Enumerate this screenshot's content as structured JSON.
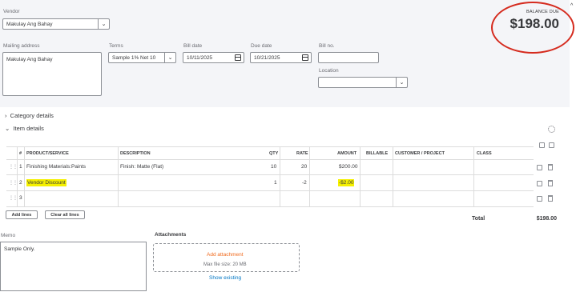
{
  "header": {
    "vendor_label": "Vendor",
    "vendor_value": "Makulay Ang Bahay",
    "balance_label": "BALANCE DUE",
    "balance_value": "$198.00",
    "mailing_label": "Mailing address",
    "mailing_value": "Makulay Ang Bahay",
    "terms_label": "Terms",
    "terms_value": "Sample 1% Net 10",
    "bill_date_label": "Bill date",
    "bill_date_value": "10/11/2025",
    "due_date_label": "Due date",
    "due_date_value": "10/21/2025",
    "bill_no_label": "Bill no.",
    "bill_no_value": "",
    "location_label": "Location",
    "location_value": ""
  },
  "sections": {
    "category_details": "Category details",
    "item_details": "Item details"
  },
  "table": {
    "columns": [
      "#",
      "PRODUCT/SERVICE",
      "DESCRIPTION",
      "QTY",
      "RATE",
      "AMOUNT",
      "BILLABLE",
      "CUSTOMER / PROJECT",
      "CLASS"
    ],
    "rows": [
      {
        "num": "1",
        "product": "Finishing Materials:Paints",
        "description": "Finish: Matte (Flat)",
        "qty": "10",
        "rate": "20",
        "amount": "$200.00"
      },
      {
        "num": "2",
        "product": "Vendor Discount",
        "description": "",
        "qty": "1",
        "rate": "-2",
        "amount": "-$2.00"
      },
      {
        "num": "3",
        "product": "",
        "description": "",
        "qty": "",
        "rate": "",
        "amount": ""
      }
    ]
  },
  "buttons": {
    "add_lines": "Add lines",
    "clear_all_lines": "Clear all lines"
  },
  "totals": {
    "label": "Total",
    "value": "$198.00"
  },
  "memo": {
    "label": "Memo",
    "value": "Sample Only."
  },
  "attachments": {
    "label": "Attachments",
    "add": "Add attachment",
    "max_size": "Max file size: 20 MB",
    "show_existing": "Show existing"
  },
  "colors": {
    "highlight": "#f5f000",
    "annotation_circle": "#d52b1e",
    "link": "#0077c5",
    "accent_orange": "#f06a1d"
  }
}
